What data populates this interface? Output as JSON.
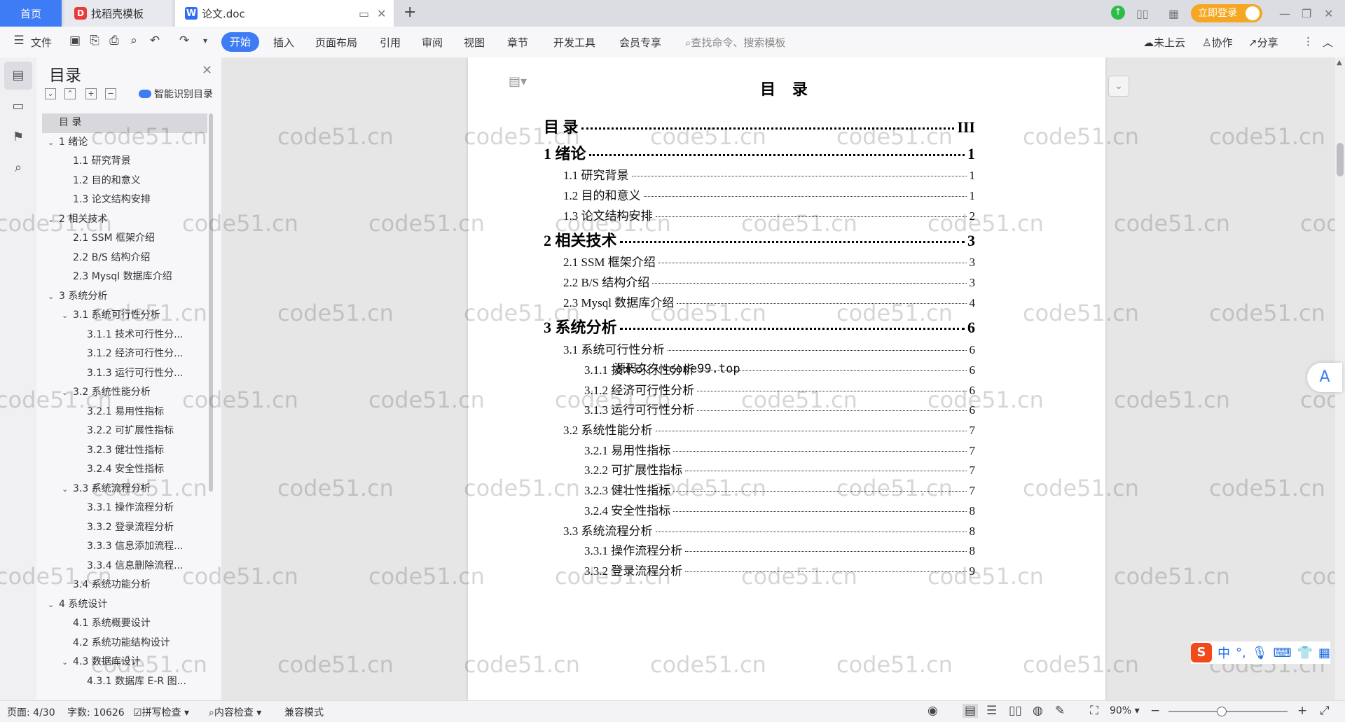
{
  "tabs": {
    "home": "首页",
    "template": "找稻壳模板",
    "doc": "论文.doc",
    "add": "+"
  },
  "window": {
    "login": "立即登录"
  },
  "toolbar": {
    "file": "文件",
    "menus": [
      "开始",
      "插入",
      "页面布局",
      "引用",
      "审阅",
      "视图",
      "章节",
      "开发工具",
      "会员专享"
    ],
    "search_placeholder": "查找命令、搜索模板",
    "cloud": "未上云",
    "collab": "协作",
    "share": "分享"
  },
  "toc_pane": {
    "title": "目录",
    "smart_detect": "智能识别目录",
    "items": [
      {
        "text": "目 录",
        "level": 0,
        "selected": true,
        "chevron": false
      },
      {
        "text": "1  绪论",
        "level": 0,
        "chevron": true
      },
      {
        "text": "1.1  研究背景",
        "level": 1,
        "chevron": false
      },
      {
        "text": "1.2  目的和意义",
        "level": 1,
        "chevron": false
      },
      {
        "text": "1.3  论文结构安排",
        "level": 1,
        "chevron": false
      },
      {
        "text": "2  相关技术",
        "level": 0,
        "chevron": true
      },
      {
        "text": "2.1  SSM 框架介绍",
        "level": 1,
        "chevron": false
      },
      {
        "text": "2.2  B/S 结构介绍",
        "level": 1,
        "chevron": false
      },
      {
        "text": "2.3  Mysql 数据库介绍",
        "level": 1,
        "chevron": false
      },
      {
        "text": "3  系统分析",
        "level": 0,
        "chevron": true
      },
      {
        "text": "3.1  系统可行性分析",
        "level": 1,
        "chevron": true
      },
      {
        "text": "3.1.1  技术可行性分...",
        "level": 2,
        "chevron": false
      },
      {
        "text": "3.1.2  经济可行性分...",
        "level": 2,
        "chevron": false
      },
      {
        "text": "3.1.3  运行可行性分...",
        "level": 2,
        "chevron": false
      },
      {
        "text": "3.2  系统性能分析",
        "level": 1,
        "chevron": true
      },
      {
        "text": "3.2.1  易用性指标",
        "level": 2,
        "chevron": false
      },
      {
        "text": "3.2.2  可扩展性指标",
        "level": 2,
        "chevron": false
      },
      {
        "text": "3.2.3  健壮性指标",
        "level": 2,
        "chevron": false
      },
      {
        "text": "3.2.4  安全性指标",
        "level": 2,
        "chevron": false
      },
      {
        "text": "3.3  系统流程分析",
        "level": 1,
        "chevron": true
      },
      {
        "text": "3.3.1  操作流程分析",
        "level": 2,
        "chevron": false
      },
      {
        "text": "3.3.2  登录流程分析",
        "level": 2,
        "chevron": false
      },
      {
        "text": "3.3.3  信息添加流程...",
        "level": 2,
        "chevron": false
      },
      {
        "text": "3.3.4  信息删除流程...",
        "level": 2,
        "chevron": false
      },
      {
        "text": "3.4  系统功能分析",
        "level": 1,
        "chevron": false
      },
      {
        "text": "4  系统设计",
        "level": 0,
        "chevron": true
      },
      {
        "text": "4.1  系统概要设计",
        "level": 1,
        "chevron": false
      },
      {
        "text": "4.2  系统功能结构设计",
        "level": 1,
        "chevron": false
      },
      {
        "text": "4.3  数据库设计",
        "level": 1,
        "chevron": true
      },
      {
        "text": "4.3.1  数据库 E-R 图...",
        "level": 2,
        "chevron": false
      }
    ]
  },
  "document": {
    "page_title": "目 录",
    "overlay_text": "源码久久-code99.top",
    "entries": [
      {
        "label": "目 录",
        "page": "III",
        "level": 0
      },
      {
        "label": "1  绪论",
        "page": "1",
        "level": 0
      },
      {
        "label": "1.1  研究背景",
        "page": "1",
        "level": 1
      },
      {
        "label": "1.2  目的和意义",
        "page": "1",
        "level": 1
      },
      {
        "label": "1.3  论文结构安排",
        "page": "2",
        "level": 1
      },
      {
        "label": "2  相关技术",
        "page": "3",
        "level": 0
      },
      {
        "label": "2.1 SSM 框架介绍",
        "page": "3",
        "level": 1
      },
      {
        "label": "2.2 B/S 结构介绍",
        "page": "3",
        "level": 1
      },
      {
        "label": "2.3 Mysql 数据库介绍",
        "page": "4",
        "level": 1
      },
      {
        "label": "3  系统分析",
        "page": "6",
        "level": 0
      },
      {
        "label": "3.1  系统可行性分析",
        "page": "6",
        "level": 1
      },
      {
        "label": "3.1.1  技术可行性分析",
        "page": "6",
        "level": 2
      },
      {
        "label": "3.1.2  经济可行性分析",
        "page": "6",
        "level": 2
      },
      {
        "label": "3.1.3  运行可行性分析",
        "page": "6",
        "level": 2
      },
      {
        "label": "3.2  系统性能分析",
        "page": "7",
        "level": 1
      },
      {
        "label": "3.2.1  易用性指标",
        "page": "7",
        "level": 2
      },
      {
        "label": "3.2.2  可扩展性指标",
        "page": "7",
        "level": 2
      },
      {
        "label": "3.2.3  健壮性指标",
        "page": "7",
        "level": 2
      },
      {
        "label": "3.2.4  安全性指标",
        "page": "8",
        "level": 2
      },
      {
        "label": "3.3  系统流程分析",
        "page": "8",
        "level": 1
      },
      {
        "label": "3.3.1  操作流程分析",
        "page": "8",
        "level": 2
      },
      {
        "label": "3.3.2  登录流程分析",
        "page": "9",
        "level": 2
      }
    ]
  },
  "watermark": "code51.cn",
  "ime": {
    "s": "S",
    "zh": "中"
  },
  "status": {
    "page": "页面: 4/30",
    "words": "字数: 10626",
    "spell": "拼写检查",
    "content": "内容检查",
    "compat": "兼容模式",
    "zoom": "90%"
  }
}
